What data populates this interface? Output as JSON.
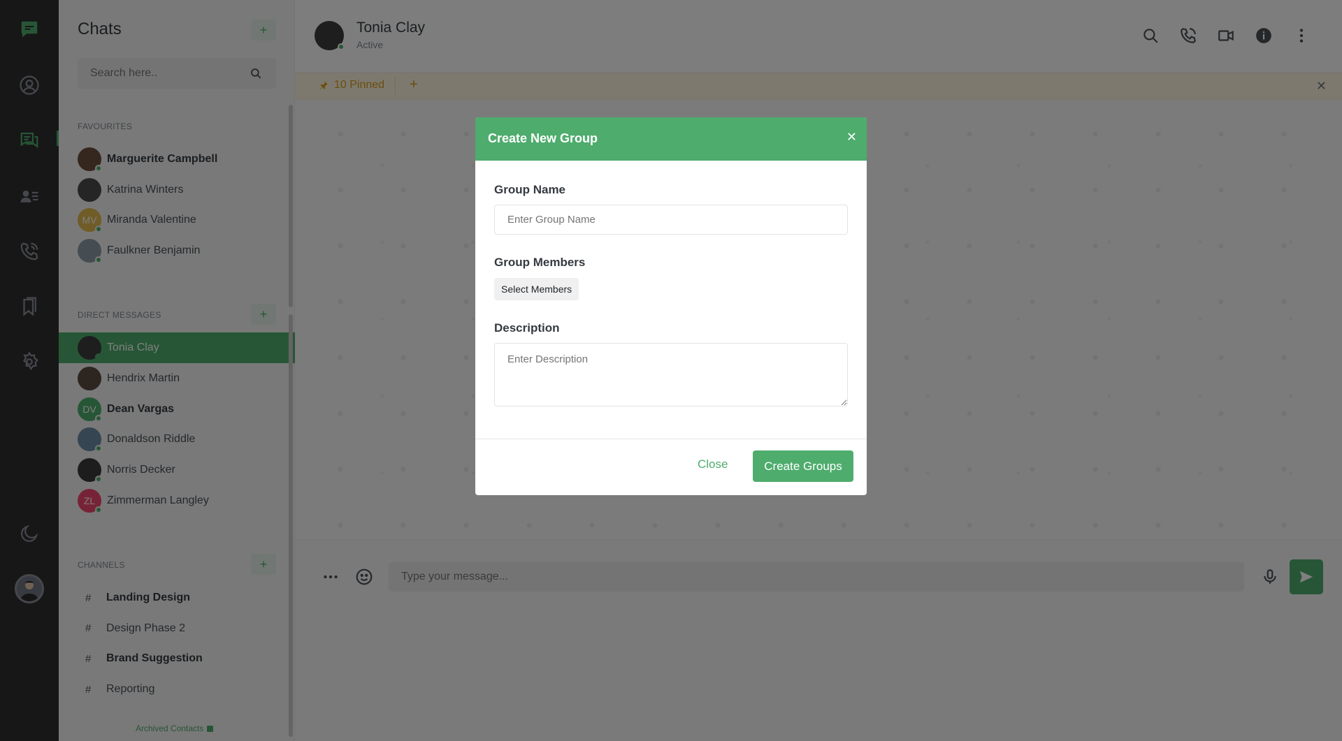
{
  "sidebar": {
    "title": "Chats",
    "search_placeholder": "Search here..",
    "favourites_label": "FAVOURITES",
    "favourites": [
      {
        "name": "Marguerite Campbell",
        "bold": true,
        "initials": "",
        "color": "#6b4f3a",
        "online": true
      },
      {
        "name": "Katrina Winters",
        "bold": false,
        "initials": "",
        "color": "#4a4a4a",
        "online": false
      },
      {
        "name": "Miranda Valentine",
        "bold": false,
        "initials": "MV",
        "color": "#e0b84d",
        "online": true
      },
      {
        "name": "Faulkner Benjamin",
        "bold": false,
        "initials": "",
        "color": "#8d9aa5",
        "online": true
      }
    ],
    "dm_label": "DIRECT MESSAGES",
    "direct_messages": [
      {
        "name": "Tonia Clay",
        "bold": false,
        "initials": "",
        "color": "#3d3d3d",
        "online": true,
        "active": true
      },
      {
        "name": "Hendrix Martin",
        "bold": false,
        "initials": "",
        "color": "#5b4a41",
        "online": false
      },
      {
        "name": "Dean Vargas",
        "bold": true,
        "initials": "DV",
        "color": "#4eac6d",
        "online": true
      },
      {
        "name": "Donaldson Riddle",
        "bold": false,
        "initials": "",
        "color": "#6c8aa4",
        "online": true
      },
      {
        "name": "Norris Decker",
        "bold": false,
        "initials": "",
        "color": "#3a3a3a",
        "online": true
      },
      {
        "name": "Zimmerman Langley",
        "bold": false,
        "initials": "ZL",
        "color": "#ef476f",
        "online": true
      }
    ],
    "channels_label": "CHANNELS",
    "channels": [
      {
        "name": "Landing Design",
        "bold": true
      },
      {
        "name": "Design Phase 2",
        "bold": false
      },
      {
        "name": "Brand Suggestion",
        "bold": true
      },
      {
        "name": "Reporting",
        "bold": false
      }
    ],
    "archived_label": "Archived Contacts"
  },
  "header": {
    "name": "Tonia Clay",
    "status": "Active"
  },
  "pinned": {
    "label": "10 Pinned"
  },
  "composer": {
    "placeholder": "Type your message..."
  },
  "modal": {
    "title": "Create New Group",
    "group_name_label": "Group Name",
    "group_name_placeholder": "Enter Group Name",
    "members_label": "Group Members",
    "select_members_label": "Select Members",
    "description_label": "Description",
    "description_placeholder": "Enter Description",
    "close_label": "Close",
    "create_label": "Create Groups"
  },
  "colors": {
    "accent": "#4eac6d",
    "rail": "#2e2e2e",
    "pin": "#d79b1a"
  }
}
